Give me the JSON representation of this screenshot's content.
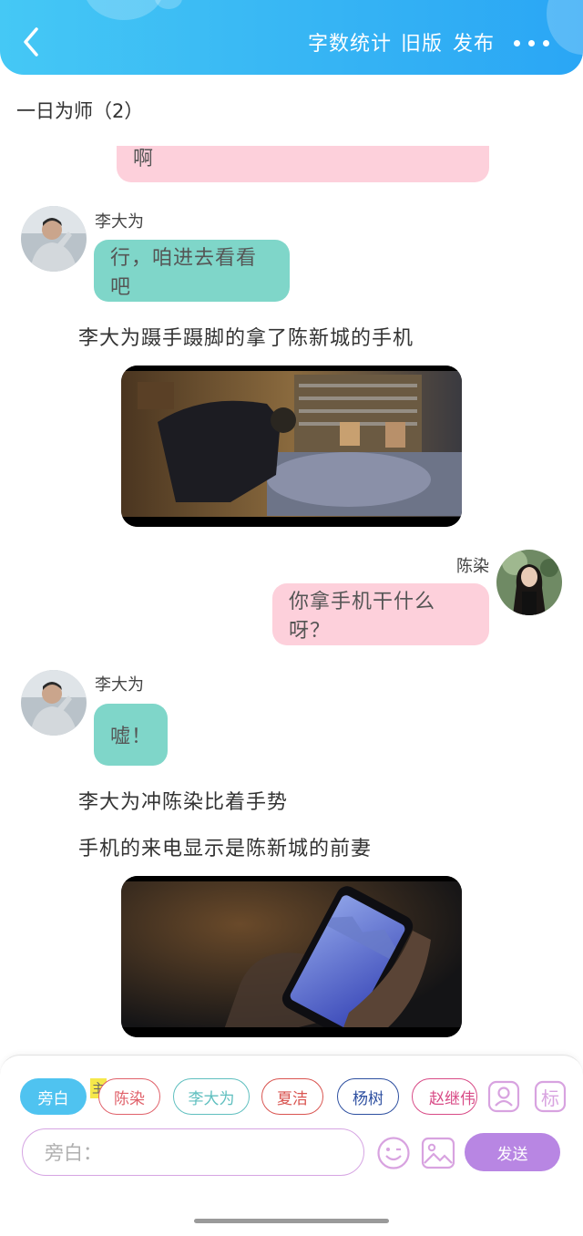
{
  "header": {
    "actions": [
      {
        "id": "wordcount",
        "label": "字数统计"
      },
      {
        "id": "oldversion",
        "label": "旧版"
      },
      {
        "id": "publish",
        "label": "发布"
      }
    ],
    "colors": {
      "gradient_start": "#45c8f5",
      "gradient_end": "#2aa6f5"
    }
  },
  "chat": {
    "title": "一日为师（2）",
    "messages": [
      {
        "type": "right",
        "speaker": "",
        "text": "啊"
      },
      {
        "type": "left",
        "speaker": "李大为",
        "text": "行，咱进去看看吧"
      },
      {
        "type": "narration",
        "text": "李大为蹑手蹑脚的拿了陈新城的手机"
      },
      {
        "type": "image",
        "subject": "bedroom-night-scene"
      },
      {
        "type": "right",
        "speaker": "陈染",
        "text": "你拿手机干什么呀？"
      },
      {
        "type": "left",
        "speaker": "李大为",
        "text": "嘘！"
      },
      {
        "type": "narration",
        "text": "李大为冲陈染比着手势"
      },
      {
        "type": "narration",
        "text": "手机的来电显示是陈新城的前妻"
      },
      {
        "type": "image",
        "subject": "phone-incoming-call"
      }
    ]
  },
  "composer": {
    "chips": [
      {
        "label": "旁白",
        "color": "#4fc3f0",
        "selected": true
      },
      {
        "label": "陈染",
        "color": "#e0616a",
        "selected": false
      },
      {
        "label": "李大为",
        "color": "#5fbfbf",
        "selected": false
      },
      {
        "label": "夏洁",
        "color": "#d95450",
        "selected": false
      },
      {
        "label": "杨树",
        "color": "#2d4fa0",
        "selected": false
      },
      {
        "label": "赵继伟",
        "color": "#d84a86",
        "selected": false
      }
    ],
    "main_tag": "主",
    "icons": [
      "contact-icon",
      "mark-icon",
      "emoji-icon",
      "image-icon"
    ],
    "mark_label": "标",
    "input_placeholder": "旁白：",
    "send_label": "发送",
    "accent": "#b886e3"
  }
}
